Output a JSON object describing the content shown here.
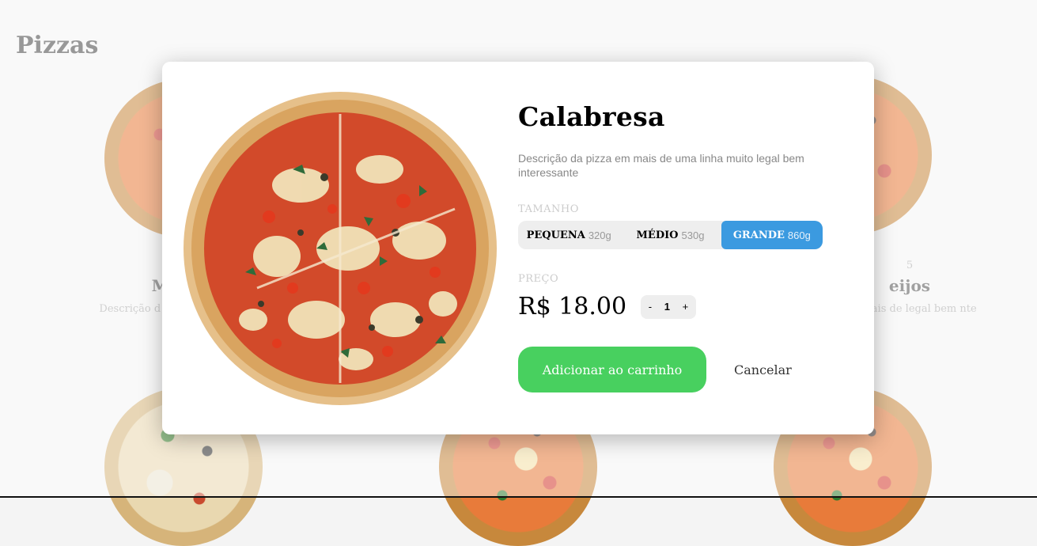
{
  "page": {
    "title": "Pizzas"
  },
  "background_cards": [
    {
      "sizes": "P",
      "name": "Mu",
      "desc": "Descrição d uma linha int"
    },
    {
      "sizes": "5",
      "name": "eijos",
      "desc": "em mais de legal bem nte"
    }
  ],
  "modal": {
    "name": "Calabresa",
    "description": "Descrição da pizza em mais de uma linha muito legal bem interessante",
    "size_label": "TAMANHO",
    "sizes": [
      {
        "name": "PEQUENA",
        "weight": "320g",
        "selected": false
      },
      {
        "name": "MÉDIO",
        "weight": "530g",
        "selected": false
      },
      {
        "name": "GRANDE",
        "weight": "860g",
        "selected": true
      }
    ],
    "price_label": "PREÇO",
    "price": "R$ 18.00",
    "quantity": {
      "minus": "-",
      "value": "1",
      "plus": "+"
    },
    "add_button": "Adicionar ao carrinho",
    "cancel": "Cancelar"
  },
  "colors": {
    "accent_blue": "#3b9ae0",
    "add_green": "#48d05f"
  }
}
